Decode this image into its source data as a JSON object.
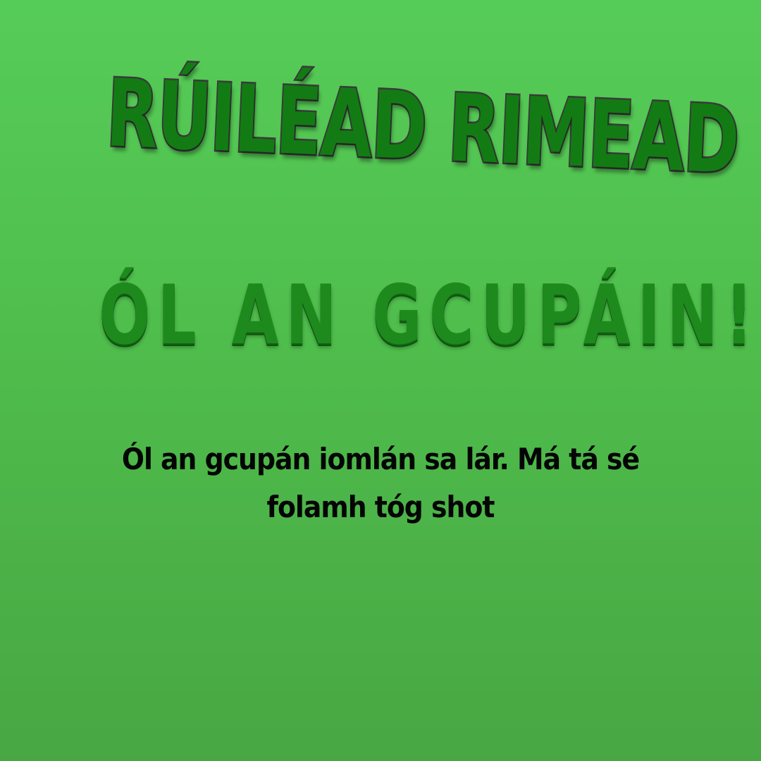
{
  "game": {
    "title": "RÚILÉAD RIMEAD"
  },
  "card": {
    "title": "ÓL AN GCUPÁIN!",
    "text_lines": [
      "Ól an gcupán iomlán sa lár. Má tá sé",
      "folamh tóg shot"
    ]
  },
  "colors": {
    "background_top": "#56cc58",
    "background_bottom": "#48a743",
    "title_fill": "#137b14",
    "title_outline": "#3a3a3a",
    "heading_fill": "#1e8a1e",
    "body_text": "#050505"
  }
}
